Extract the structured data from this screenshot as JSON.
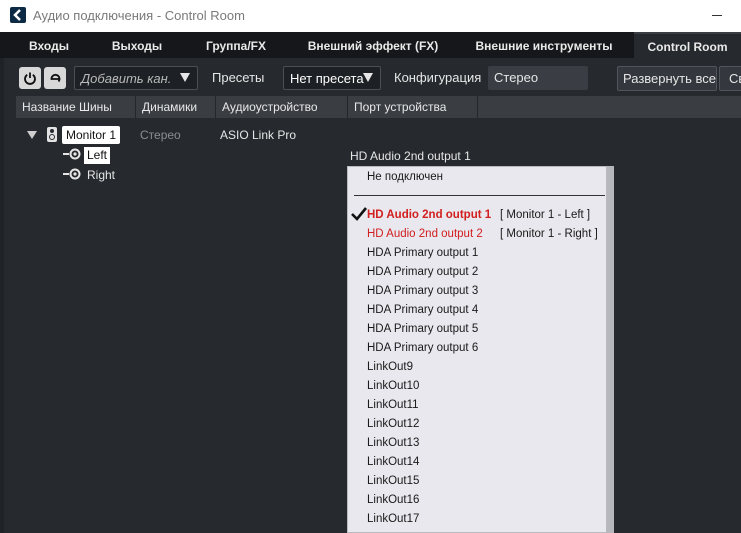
{
  "window": {
    "title": "Аудио подключения - Control Room"
  },
  "tabs": [
    {
      "label": "Входы",
      "active": false
    },
    {
      "label": "Выходы",
      "active": false
    },
    {
      "label": "Группа/FX",
      "active": false
    },
    {
      "label": "Внешний эффект (FX)",
      "active": false
    },
    {
      "label": "Внешние инструменты",
      "active": false
    },
    {
      "label": "Control Room",
      "active": true
    }
  ],
  "toolbar": {
    "add_channel_placeholder": "Добавить кан.",
    "presets_label": "Пресеты",
    "presets_value": "Нет пресета",
    "config_label": "Конфигурация",
    "config_value": "Стерео",
    "expand_all_label": "Развернуть все",
    "more_label": "Св"
  },
  "columns": [
    "Название Шины",
    "Динамики",
    "Аудиоустройство",
    "Порт устройства"
  ],
  "bus": {
    "name": "Monitor 1",
    "speakers": "Стерео",
    "device": "ASIO Link Pro",
    "channels": [
      {
        "name": "Left",
        "port": "HD Audio 2nd output 1"
      },
      {
        "name": "Right",
        "port": ""
      }
    ]
  },
  "port_menu": {
    "items": [
      {
        "label": "Не подключен",
        "assigned": "",
        "state": "normal"
      },
      {
        "label": "HD Audio 2nd output 1",
        "assigned": "[ Monitor 1 - Left ]",
        "state": "selected"
      },
      {
        "label": "HD Audio 2nd output 2",
        "assigned": "[ Monitor 1 - Right ]",
        "state": "used"
      },
      {
        "label": "HDA Primary output 1",
        "assigned": "",
        "state": "normal"
      },
      {
        "label": "HDA Primary output 2",
        "assigned": "",
        "state": "normal"
      },
      {
        "label": "HDA Primary output 3",
        "assigned": "",
        "state": "normal"
      },
      {
        "label": "HDA Primary output 4",
        "assigned": "",
        "state": "normal"
      },
      {
        "label": "HDA Primary output 5",
        "assigned": "",
        "state": "normal"
      },
      {
        "label": "HDA Primary output 6",
        "assigned": "",
        "state": "normal"
      },
      {
        "label": "LinkOut9",
        "assigned": "",
        "state": "normal"
      },
      {
        "label": "LinkOut10",
        "assigned": "",
        "state": "normal"
      },
      {
        "label": "LinkOut11",
        "assigned": "",
        "state": "normal"
      },
      {
        "label": "LinkOut12",
        "assigned": "",
        "state": "normal"
      },
      {
        "label": "LinkOut13",
        "assigned": "",
        "state": "normal"
      },
      {
        "label": "LinkOut14",
        "assigned": "",
        "state": "normal"
      },
      {
        "label": "LinkOut15",
        "assigned": "",
        "state": "normal"
      },
      {
        "label": "LinkOut16",
        "assigned": "",
        "state": "normal"
      },
      {
        "label": "LinkOut17",
        "assigned": "",
        "state": "normal"
      }
    ]
  },
  "colors": {
    "accent_red": "#d21e1e",
    "panel_bg": "#262a2f",
    "menu_bg": "#e8e8ee"
  }
}
